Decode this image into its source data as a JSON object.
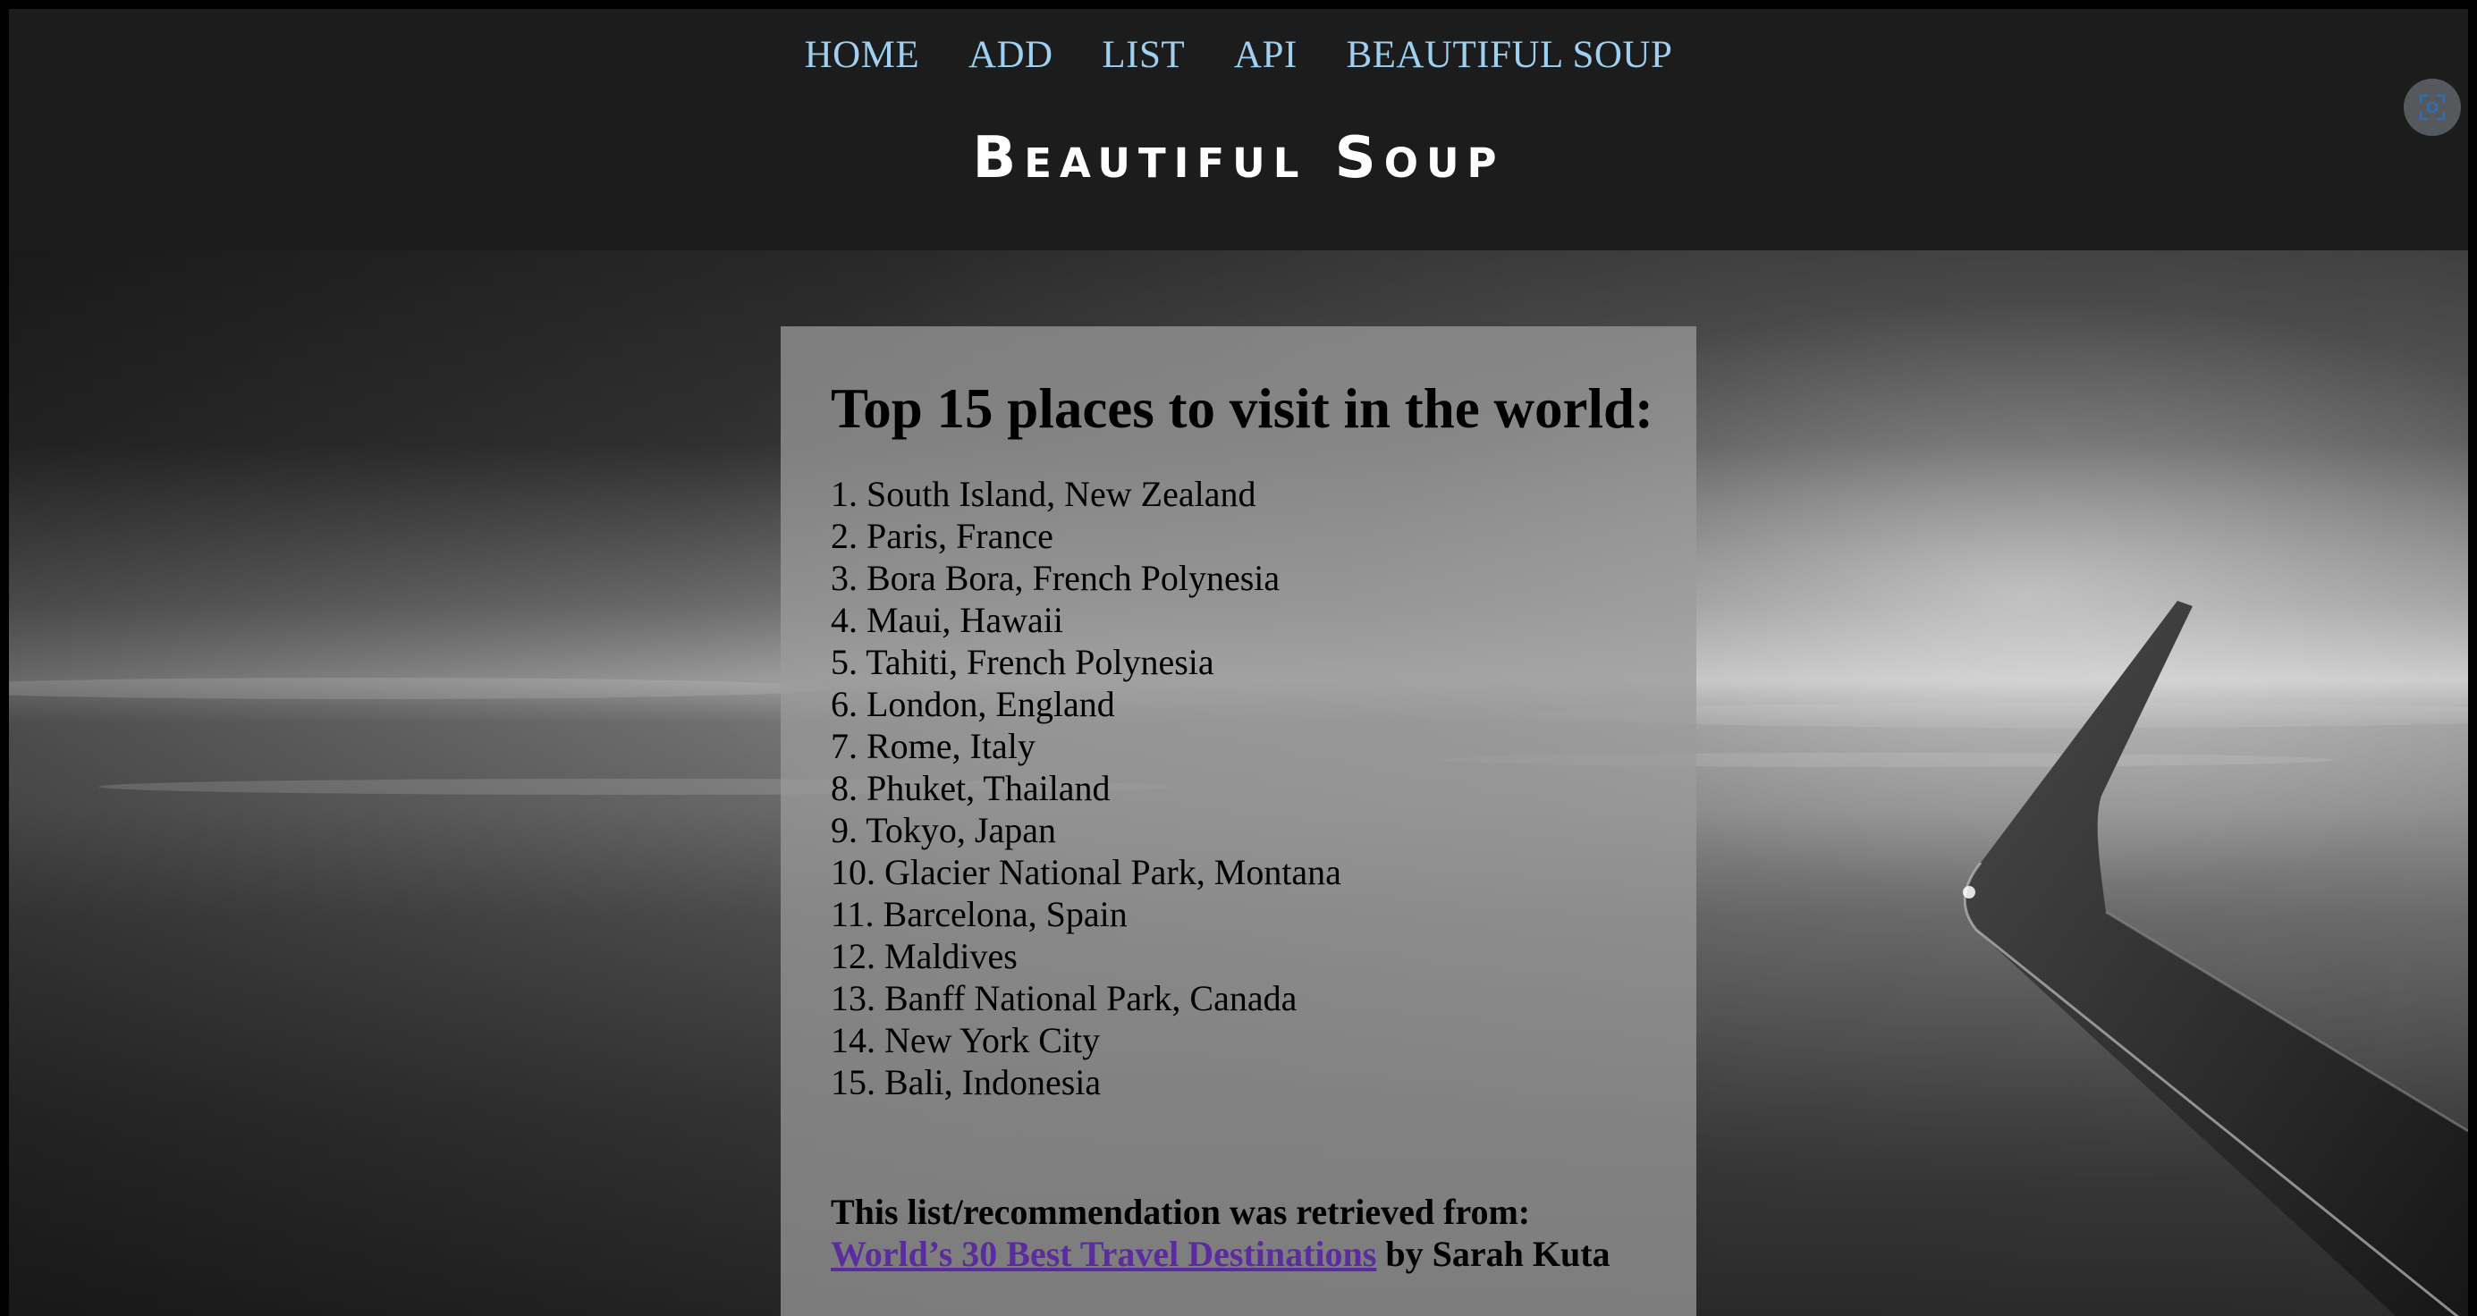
{
  "nav": {
    "items": [
      "HOME",
      "ADD",
      "LIST",
      "API",
      "BEAUTIFUL SOUP"
    ]
  },
  "header": {
    "title": "Beautiful Soup"
  },
  "main": {
    "heading": "Top 15 places to visit in the world:",
    "places": [
      "1. South Island, New Zealand",
      "2. Paris, France",
      "3. Bora Bora, French Polynesia",
      "4. Maui, Hawaii",
      "5. Tahiti, French Polynesia",
      "6. London, England",
      "7. Rome, Italy",
      "8. Phuket, Thailand",
      "9. Tokyo, Japan",
      "10. Glacier National Park, Montana",
      "11. Barcelona, Spain",
      "12. Maldives",
      "13. Banff National Park, Canada",
      "14. New York City",
      "15. Bali, Indonesia"
    ],
    "source_intro": "This list/recommendation was retrieved from:",
    "source_link": "World’s 30 Best Travel Destinations",
    "source_author": "by Sarah Kuta"
  },
  "icons": {
    "screenshot": "screenshot-icon"
  },
  "colors": {
    "header_bg": "#1c1c1d",
    "nav_link": "#9fd0ef",
    "title": "#ffffff",
    "card_bg": "#9b9b9b",
    "source_link": "#5b2c9e"
  }
}
